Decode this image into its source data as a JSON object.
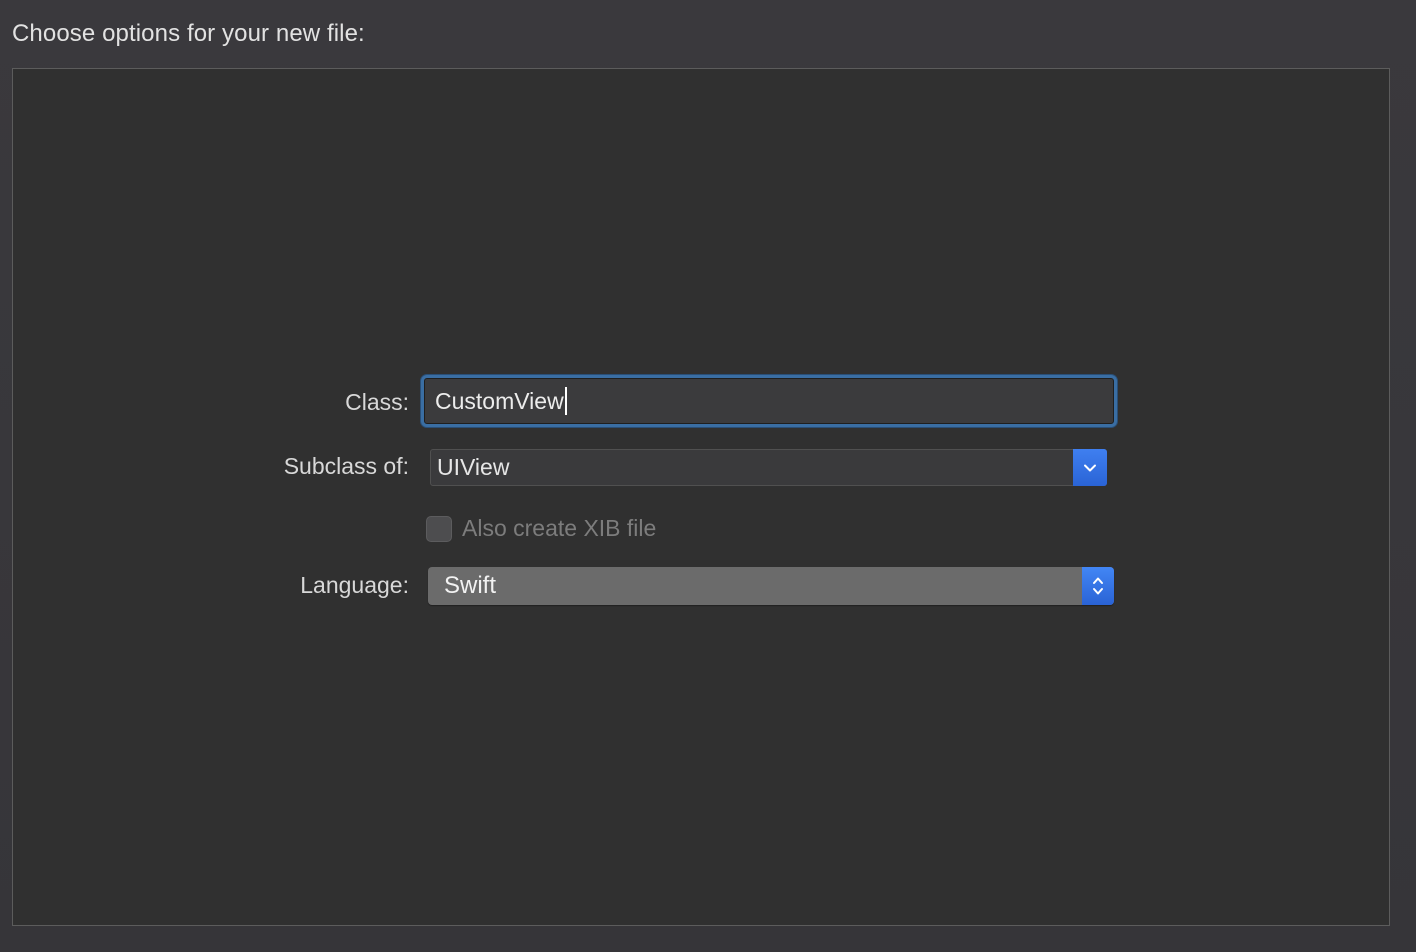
{
  "dialog": {
    "heading": "Choose options for your new file:"
  },
  "form": {
    "class_label": "Class:",
    "class_value": "CustomView",
    "subclass_label": "Subclass of:",
    "subclass_value": "UIView",
    "xib_checkbox_label": "Also create XIB file",
    "xib_checkbox_checked": false,
    "xib_checkbox_enabled": false,
    "language_label": "Language:",
    "language_value": "Swift"
  },
  "icons": {
    "subclass_dropdown": "chevron-down-icon",
    "language_stepper": "up-down-chevron-icon"
  },
  "colors": {
    "accent": "#2f6be0",
    "focus_ring": "#3a6ea3"
  }
}
